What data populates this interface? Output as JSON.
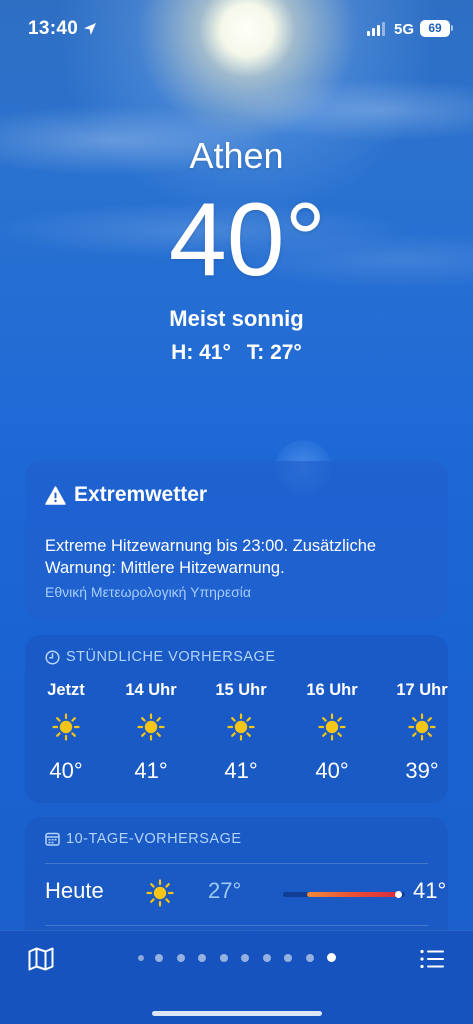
{
  "status_bar": {
    "time": "13:40",
    "network": "5G",
    "battery": "69"
  },
  "weather": {
    "city": "Athen",
    "temperature": "40°",
    "condition": "Meist sonnig",
    "high": "H: 41°",
    "low": "T: 27°"
  },
  "alert": {
    "title": "Extremwetter",
    "text": "Extreme Hitzewarnung bis 23:00. Zusätzliche Warnung: Mittlere Hitzewarnung.",
    "source": "Εθνική Μετεωρολογική Υπηρεσία"
  },
  "hourly": {
    "heading": "STÜNDLICHE VORHERSAGE",
    "items": [
      {
        "label": "Jetzt",
        "temp": "40°",
        "icon": "sun-icon"
      },
      {
        "label": "14 Uhr",
        "temp": "41°",
        "icon": "sun-icon"
      },
      {
        "label": "15 Uhr",
        "temp": "41°",
        "icon": "sun-icon"
      },
      {
        "label": "16 Uhr",
        "temp": "40°",
        "icon": "sun-icon"
      },
      {
        "label": "17 Uhr",
        "temp": "39°",
        "icon": "sun-icon"
      }
    ]
  },
  "daily": {
    "heading": "10-TAGE-VORHERSAGE",
    "items": [
      {
        "day": "Heute",
        "low": "27°",
        "high": "41°",
        "icon": "sun-icon"
      }
    ]
  },
  "toolbar": {
    "page_count": 10,
    "active_page": 10
  },
  "colors": {
    "sun": "#F5C518",
    "temp_bar_start": "#F08A3A",
    "temp_bar_end": "#D62B3E",
    "secondary_text": "#B3D3FB"
  }
}
